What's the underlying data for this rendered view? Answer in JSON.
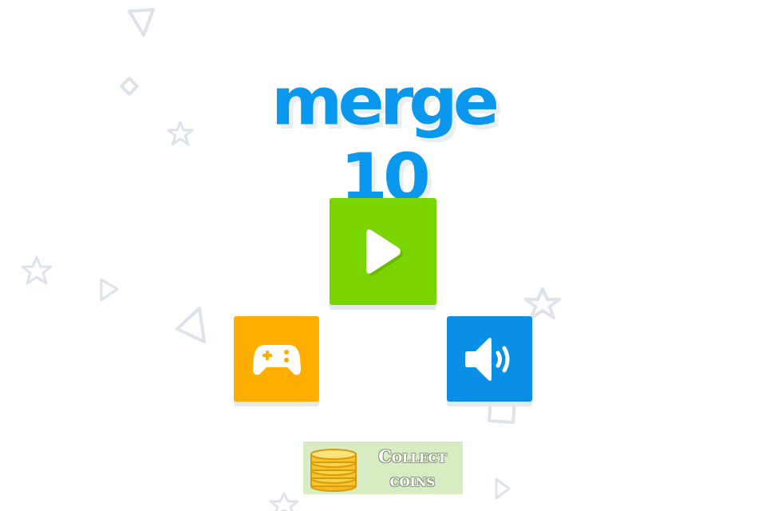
{
  "game": {
    "title": "merge 10"
  },
  "menu": {
    "play": {
      "icon": "play-icon"
    },
    "more_games": {
      "icon": "gamepad-icon"
    },
    "sound": {
      "icon": "speaker-on-icon",
      "state": "on"
    }
  },
  "collect": {
    "line1": "Collect",
    "line2": "coins",
    "icon": "coin-stack-icon"
  },
  "colors": {
    "title": "#0a98ee",
    "play": "#79d400",
    "games": "#ffae00",
    "sound": "#0a8fe6",
    "collect_bg": "#d8ecc4",
    "coin": "#f7c42a",
    "decor_outline": "#dde3e8"
  },
  "decor": {
    "shapes": [
      "triangle",
      "diamond",
      "star",
      "star",
      "triangle",
      "triangle",
      "star",
      "square",
      "square",
      "triangle",
      "star"
    ]
  }
}
